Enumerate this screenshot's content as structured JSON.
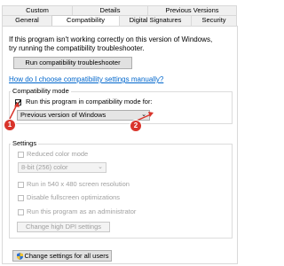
{
  "tabs_back": [
    {
      "label": "Custom"
    },
    {
      "label": "Details"
    },
    {
      "label": "Previous Versions"
    }
  ],
  "tabs_front": [
    {
      "label": "General"
    },
    {
      "label": "Compatibility",
      "active": true
    },
    {
      "label": "Digital Signatures"
    },
    {
      "label": "Security"
    }
  ],
  "intro_text_1": "If this program isn't working correctly on this version of Windows,",
  "intro_text_2": "try running the compatibility troubleshooter.",
  "troubleshooter_button": "Run compatibility troubleshooter",
  "manual_link": "How do I choose compatibility settings manually?",
  "compat_mode": {
    "group_label": "Compatibility mode",
    "checkbox_label": "Run this program in compatibility mode for:",
    "checked": true,
    "select_value": "Previous version of Windows"
  },
  "settings": {
    "group_label": "Settings",
    "reduced_color": "Reduced color mode",
    "color_select": "8-bit (256) color",
    "run_640": "Run in 540 x 480 screen resolution",
    "disable_fullscreen": "Disable fullscreen optimizations",
    "run_admin": "Run this program as an administrator",
    "high_dpi_button": "Change high DPI settings"
  },
  "all_users_button": "Change settings for all users",
  "markers": [
    "1",
    "2"
  ],
  "colors": {
    "accent": "#0066cc",
    "marker": "#d9342b"
  }
}
